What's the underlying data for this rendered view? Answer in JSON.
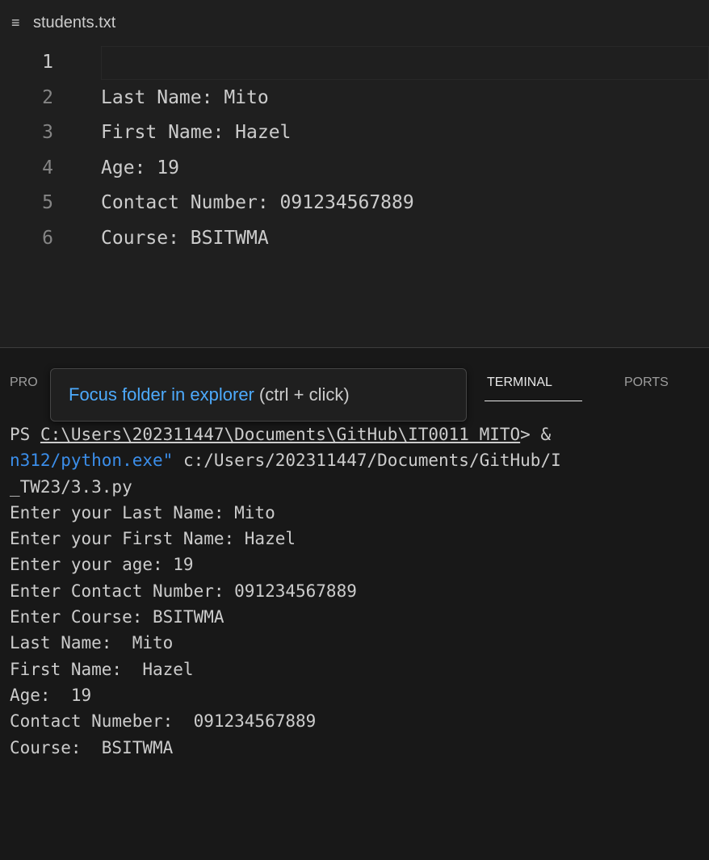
{
  "editor": {
    "file_name": "students.txt",
    "file_icon": "lines-icon",
    "lines": [
      {
        "num": "1",
        "text": ""
      },
      {
        "num": "2",
        "text": "Last Name: Mito"
      },
      {
        "num": "3",
        "text": "First Name: Hazel"
      },
      {
        "num": "4",
        "text": "Age: 19"
      },
      {
        "num": "5",
        "text": "Contact Number: 091234567889"
      },
      {
        "num": "6",
        "text": "Course: BSITWMA"
      }
    ]
  },
  "panel": {
    "tabs": {
      "problems": "PRO",
      "terminal": "TERMINAL",
      "ports": "PORTS"
    },
    "tooltip": {
      "link": "Focus folder in explorer",
      "hint": "(ctrl + click)"
    }
  },
  "terminal": {
    "prompt_prefix": "PS ",
    "prompt_path": "C:\\Users\\202311447\\Documents\\GitHub\\IT0011 MITO",
    "prompt_suffix": "> &",
    "line2_string": "n312/python.exe\"",
    "line2_rest": " c:/Users/202311447/Documents/GitHub/I",
    "line3": "_TW23/3.3.py",
    "output": [
      "Enter your Last Name: Mito",
      "Enter your First Name: Hazel",
      "Enter your age: 19",
      "Enter Contact Number: 091234567889",
      "Enter Course: BSITWMA",
      "Last Name:  Mito",
      "First Name:  Hazel",
      "Age:  19",
      "Contact Numeber:  091234567889",
      "Course:  BSITWMA"
    ]
  },
  "colors": {
    "background": "#1e1e1e",
    "link_blue": "#4daafc",
    "string_blue": "#3b8eea"
  }
}
